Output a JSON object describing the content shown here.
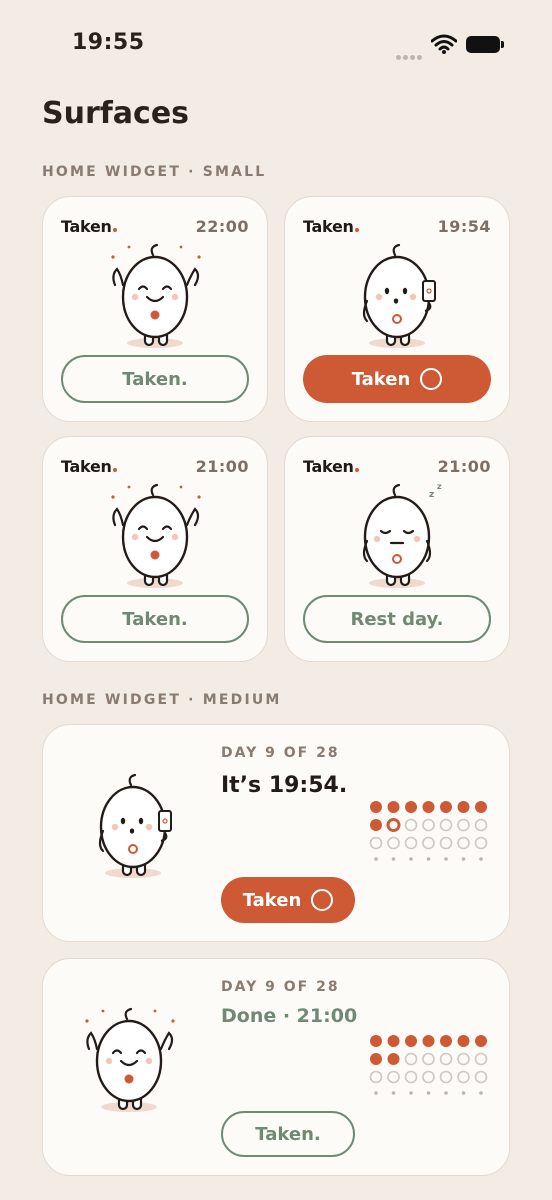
{
  "status_bar": {
    "time": "19:55"
  },
  "page": {
    "title": "Surfaces"
  },
  "sections": {
    "small": "HOME WIDGET · SMALL",
    "medium": "HOME WIDGET · MEDIUM"
  },
  "small_widgets": [
    {
      "brand": "Taken",
      "time": "22:00",
      "button": "Taken.",
      "mood": "happy",
      "style": "outline"
    },
    {
      "brand": "Taken",
      "time": "19:54",
      "button": "Taken",
      "mood": "phone",
      "style": "fill"
    },
    {
      "brand": "Taken",
      "time": "21:00",
      "button": "Taken.",
      "mood": "happy",
      "style": "outline"
    },
    {
      "brand": "Taken",
      "time": "21:00",
      "button": "Rest day.",
      "mood": "sleep",
      "style": "outline"
    }
  ],
  "medium_widgets": [
    {
      "day": "DAY 9 OF 28",
      "headline": "It’s 19:54.",
      "button": "Taken",
      "style": "fill",
      "filled": 9,
      "current": 9
    },
    {
      "day": "DAY 9 OF 28",
      "headline": "Done · 21:00",
      "button": "Taken.",
      "style": "outline",
      "filled": 9,
      "current": 0
    }
  ],
  "colors": {
    "accent": "#cd5a35",
    "sage": "#6f8a72",
    "background": "#f3ece4"
  }
}
